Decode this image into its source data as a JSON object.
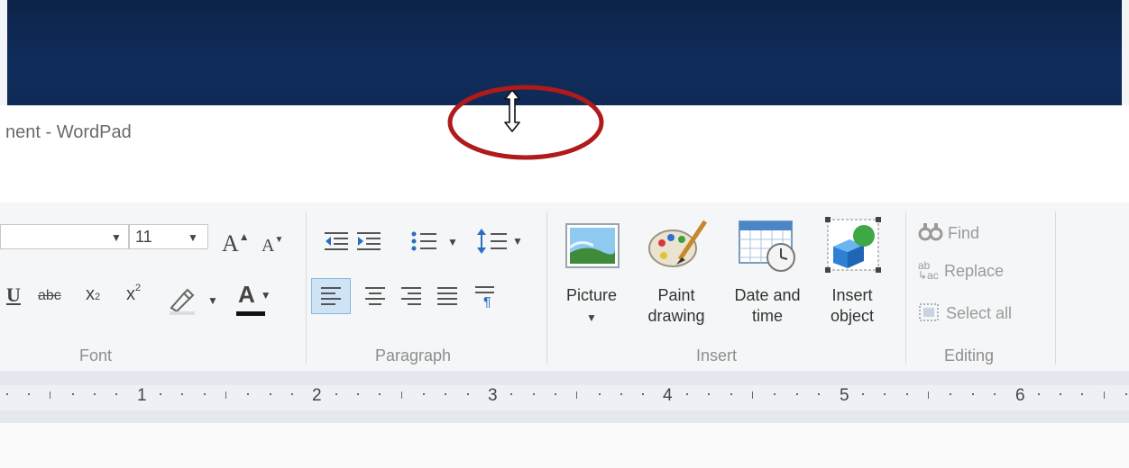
{
  "window": {
    "title": "nent - WordPad"
  },
  "ribbon": {
    "font": {
      "family_value": "",
      "size_value": "11",
      "grow_label": "A",
      "shrink_label": "A",
      "underline_label": "U",
      "strike_label": "abc",
      "subscript_label": "x",
      "superscript_label": "x",
      "text_color_label": "A",
      "group_label": "Font"
    },
    "paragraph": {
      "group_label": "Paragraph"
    },
    "insert": {
      "picture_label": "Picture",
      "paint_label_1": "Paint",
      "paint_label_2": "drawing",
      "datetime_label_1": "Date and",
      "datetime_label_2": "time",
      "object_label_1": "Insert",
      "object_label_2": "object",
      "group_label": "Insert"
    },
    "editing": {
      "find_label": "Find",
      "replace_label": "Replace",
      "select_all_label": "Select all",
      "group_label": "Editing"
    }
  },
  "ruler": {
    "numbers": [
      "1",
      "2",
      "3",
      "4",
      "5",
      "6"
    ]
  },
  "icons": [
    "resize-cursor-icon",
    "decrease-indent-icon",
    "increase-indent-icon",
    "bullets-icon",
    "line-spacing-icon",
    "align-left-icon",
    "align-center-icon",
    "align-right-icon",
    "justify-icon",
    "paragraph-icon",
    "picture-icon",
    "paint-drawing-icon",
    "date-time-icon",
    "insert-object-icon",
    "binoculars-icon",
    "replace-icon",
    "select-all-icon"
  ],
  "colors": {
    "title_bar": "#ffffff",
    "desktop": "#102d5c",
    "annotation": "#b01a1a",
    "ribbon": "#f5f6f7"
  }
}
